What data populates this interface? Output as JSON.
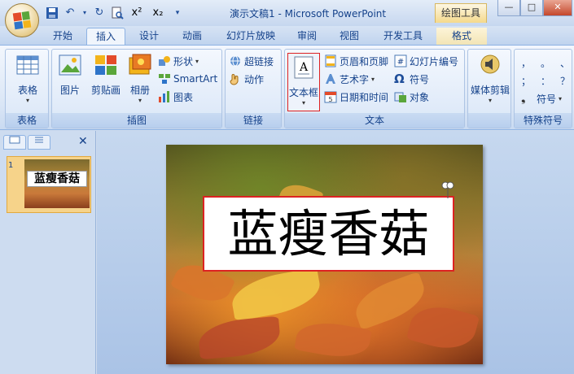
{
  "window": {
    "title": "演示文稿1 - Microsoft PowerPoint",
    "context_tool": "绘图工具"
  },
  "quick_access": [
    "save-icon",
    "undo-icon",
    "redo-icon",
    "print-preview-icon",
    "superscript-icon",
    "subscript-icon",
    "customize-icon"
  ],
  "quick_access_labels": {
    "superscript": "x²",
    "subscript": "x₂"
  },
  "tabs": [
    {
      "label": "开始"
    },
    {
      "label": "插入"
    },
    {
      "label": "设计"
    },
    {
      "label": "动画"
    },
    {
      "label": "幻灯片放映"
    },
    {
      "label": "审阅"
    },
    {
      "label": "视图"
    },
    {
      "label": "开发工具"
    },
    {
      "label": "格式"
    }
  ],
  "ribbon": {
    "groups": {
      "table": "表格",
      "illustrations": "插图",
      "links": "链接",
      "text": "文本",
      "media": "",
      "special": "特殊符号"
    },
    "buttons": {
      "table": "表格",
      "picture": "图片",
      "clipart": "剪贴画",
      "album": "相册",
      "shapes": "形状",
      "smartart": "SmartArt",
      "chart": "图表",
      "hyperlink": "超链接",
      "action": "动作",
      "textbox": "文本框",
      "header_footer": "页眉和页脚",
      "wordart": "艺术字",
      "datetime": "日期和时间",
      "slide_number": "幻灯片编号",
      "symbol": "符号",
      "object": "对象",
      "media_clip": "媒体剪辑",
      "symbol_special": "符号"
    },
    "special_symbols": [
      "，",
      "。",
      "、",
      "；",
      "：",
      "？"
    ]
  },
  "slides_panel": {
    "slide_number": "1",
    "thumbnail_text": "蓝瘦香菇"
  },
  "slide": {
    "textbox_text": "蓝瘦香菇"
  },
  "colors": {
    "selection_red": "#dd2222",
    "ribbon_blue": "#15428b"
  }
}
